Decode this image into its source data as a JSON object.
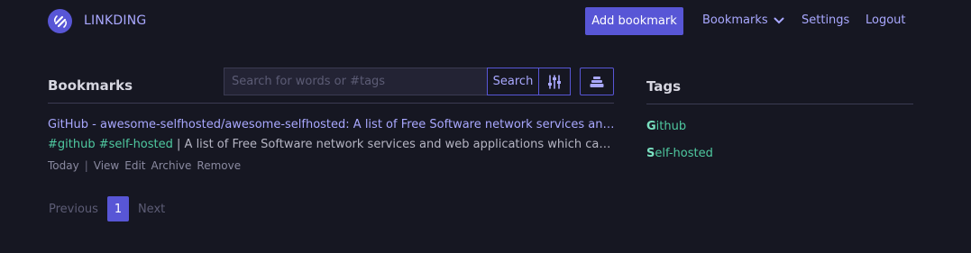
{
  "header": {
    "app_name": "LINKDING",
    "add_bookmark_label": "Add bookmark",
    "nav": {
      "bookmarks": "Bookmarks",
      "settings": "Settings",
      "logout": "Logout"
    }
  },
  "bookmarks_section": {
    "title": "Bookmarks",
    "search": {
      "placeholder": "Search for words or #tags",
      "value": "",
      "button_label": "Search"
    }
  },
  "bookmarks": [
    {
      "title": "GitHub - awesome-selfhosted/awesome-selfhosted: A list of Free Software network services and web applications which can be hosted on your own servers",
      "tags": [
        "#github",
        "#self-hosted"
      ],
      "separator": " | ",
      "description": "A list of Free Software network services and web applications which can be hosted on your own servers",
      "date": "Today",
      "action_separator": "|",
      "actions": {
        "view": "View",
        "edit": "Edit",
        "archive": "Archive",
        "remove": "Remove"
      }
    }
  ],
  "pagination": {
    "previous": "Previous",
    "current": "1",
    "next": "Next"
  },
  "tags_section": {
    "title": "Tags",
    "tags": [
      {
        "first": "G",
        "rest": "ithub"
      },
      {
        "first": "S",
        "rest": "elf-hosted"
      }
    ]
  },
  "colors": {
    "background": "#161722",
    "accent": "#5856d6",
    "link": "#a9a8ff",
    "tag": "#4fc9a0"
  },
  "icons": {
    "logo": "link-logo-icon",
    "dropdown": "chevron-down-icon",
    "filter": "sliders-icon",
    "bulk_edit": "stack-icon"
  }
}
